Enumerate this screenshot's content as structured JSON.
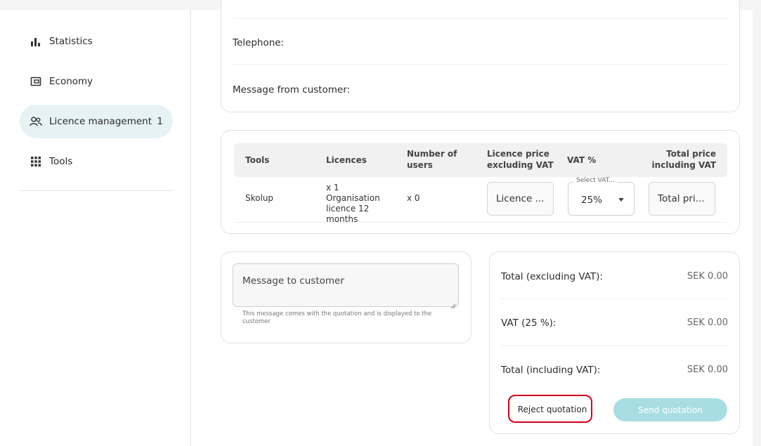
{
  "sidebar": {
    "items": [
      {
        "label": "Statistics",
        "icon": "bar-chart-icon"
      },
      {
        "label": "Economy",
        "icon": "wallet-icon"
      },
      {
        "label": "Licence management",
        "icon": "users-icon",
        "count": "1",
        "active": true
      },
      {
        "label": "Tools",
        "icon": "grid-icon"
      }
    ]
  },
  "customer_info": {
    "telephone_label": "Telephone:",
    "message_label": "Message from customer:"
  },
  "licence_table": {
    "headers": [
      "Tools",
      "Licences",
      "Number of users",
      "Licence price excluding VAT",
      "VAT %",
      "Total price including VAT"
    ],
    "row": {
      "tool": "Skolup",
      "licences": "x 1 Organisation licence 12 months",
      "users": "x 0",
      "licence_price_placeholder": "Licence ...",
      "vat_legend": "Select VAT...",
      "vat_value": "25%",
      "total_price_placeholder": "Total pri..."
    }
  },
  "message": {
    "placeholder": "Message to customer",
    "help": "This message comes with the quotation and is displayed to the customer"
  },
  "totals": {
    "excl_label": "Total (excluding VAT):",
    "excl_value": "SEK 0.00",
    "vat_label": "VAT (25 %):",
    "vat_value": "SEK 0.00",
    "incl_label": "Total (including VAT):",
    "incl_value": "SEK 0.00"
  },
  "actions": {
    "reject_label": "Reject quotation",
    "send_label": "Send quotation"
  },
  "colors": {
    "accent": "#a9dde4",
    "active_nav": "#e6f2f4",
    "highlight": "#d0021b"
  }
}
